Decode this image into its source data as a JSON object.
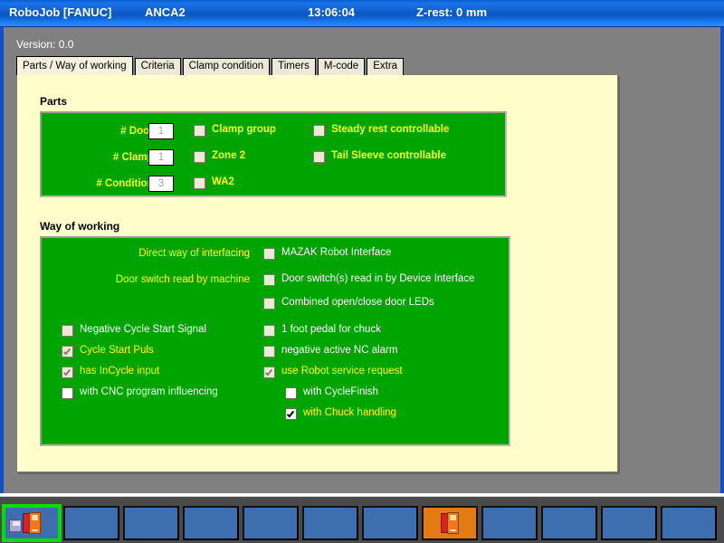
{
  "titlebar": {
    "app": "RoboJob [FANUC]",
    "machine": "ANCA2",
    "time": "13:06:04",
    "zrest": "Z-rest: 0 mm"
  },
  "version_label": "Version: 0.0",
  "tabs": [
    {
      "label": "Parts / Way of working",
      "active": true
    },
    {
      "label": "Criteria",
      "active": false
    },
    {
      "label": "Clamp condition",
      "active": false
    },
    {
      "label": "Timers",
      "active": false
    },
    {
      "label": "M-code",
      "active": false
    },
    {
      "label": "Extra",
      "active": false
    }
  ],
  "parts": {
    "title": "Parts",
    "fields": [
      {
        "label": "# Doors",
        "value": "1"
      },
      {
        "label": "# Clamps",
        "value": "1"
      },
      {
        "label": "# Conditions",
        "value": "3"
      }
    ],
    "checks_mid": [
      {
        "label": "Clamp group",
        "checked": false,
        "enabled": false
      },
      {
        "label": "Zone 2",
        "checked": false,
        "enabled": false
      },
      {
        "label": "WA2",
        "checked": false,
        "enabled": false
      }
    ],
    "checks_right": [
      {
        "label": "Steady rest controllable",
        "checked": false,
        "enabled": false
      },
      {
        "label": "Tail Sleeve controllable",
        "checked": false,
        "enabled": false
      }
    ]
  },
  "way_of_working": {
    "title": "Way of working",
    "right_labels": [
      "Direct way of interfacing",
      "Door switch read by machine"
    ],
    "top_right_checks": [
      {
        "label": "MAZAK Robot Interface",
        "checked": false
      },
      {
        "label": "Door switch(s) read in by Device Interface",
        "checked": false
      },
      {
        "label": "Combined open/close door LEDs",
        "checked": false
      }
    ],
    "left_checks": [
      {
        "label": "Negative Cycle Start Signal",
        "checked": false,
        "enabled": false,
        "color": "w"
      },
      {
        "label": "Cycle Start Puls",
        "checked": true,
        "enabled": false,
        "color": "y"
      },
      {
        "label": "has InCycle input",
        "checked": true,
        "enabled": false,
        "color": "y"
      },
      {
        "label": "with CNC program influencing",
        "checked": false,
        "enabled": true,
        "color": "w"
      }
    ],
    "right_checks": [
      {
        "label": "1 foot pedal for chuck",
        "checked": false,
        "enabled": false,
        "color": "w"
      },
      {
        "label": "negative active NC alarm",
        "checked": false,
        "enabled": false,
        "color": "w"
      },
      {
        "label": "use Robot service request",
        "checked": true,
        "enabled": false,
        "color": "y"
      }
    ],
    "sub_checks": [
      {
        "label": "with CycleFinish",
        "checked": false,
        "enabled": true,
        "color": "w"
      },
      {
        "label": "with Chuck handling",
        "checked": true,
        "enabled": true,
        "color": "y"
      }
    ]
  },
  "taskbar": {
    "buttons": [
      {
        "state": "selected",
        "icon": "save-machine-icon"
      },
      {
        "state": "empty",
        "icon": ""
      },
      {
        "state": "empty",
        "icon": ""
      },
      {
        "state": "empty",
        "icon": ""
      },
      {
        "state": "empty",
        "icon": ""
      },
      {
        "state": "empty",
        "icon": ""
      },
      {
        "state": "empty",
        "icon": ""
      },
      {
        "state": "active",
        "icon": "machine-icon"
      },
      {
        "state": "empty",
        "icon": ""
      },
      {
        "state": "empty",
        "icon": ""
      },
      {
        "state": "empty",
        "icon": ""
      },
      {
        "state": "empty",
        "icon": ""
      }
    ]
  },
  "colors": {
    "titlebar_blue": "#0b58c6",
    "panel_cream": "#ffffcc",
    "group_green": "#00a400",
    "label_yellow": "#ffff00",
    "taskbar_dark": "#4a4a4a",
    "task_button_blue": "#3d6eb0",
    "task_button_active_orange": "#e07c12",
    "focus_green": "#00e000"
  }
}
